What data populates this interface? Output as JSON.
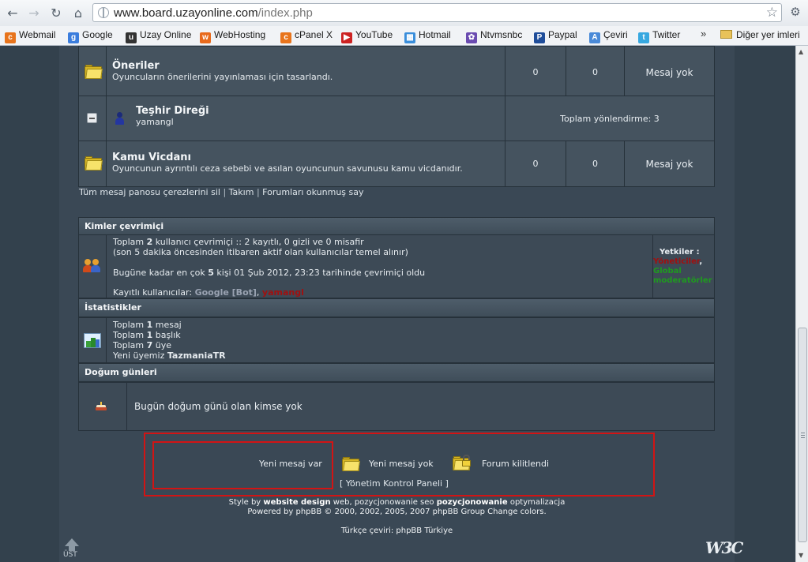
{
  "browser": {
    "url_host": "www.board.uzayonline.com",
    "url_path": "/index.php",
    "bookmarks": [
      {
        "label": "Webmail",
        "icon": "cpanel-icon",
        "color": "#e8741c"
      },
      {
        "label": "Google",
        "icon": "google-icon",
        "color": "#3b7ddd"
      },
      {
        "label": "Uzay Online",
        "icon": "uzay-icon",
        "color": "#333333"
      },
      {
        "label": "WebHosting",
        "icon": "webhosting-icon",
        "color": "#e86a1c"
      },
      {
        "label": "cPanel X",
        "icon": "cpanel-icon",
        "color": "#e8741c"
      },
      {
        "label": "YouTube",
        "icon": "youtube-icon",
        "color": "#cc2222"
      },
      {
        "label": "Hotmail",
        "icon": "windows-icon",
        "color": "#3a8edb"
      },
      {
        "label": "Ntvmsnbc",
        "icon": "nbc-icon",
        "color": "#6a4bb0"
      },
      {
        "label": "Paypal",
        "icon": "paypal-icon",
        "color": "#1f4d9a"
      },
      {
        "label": "Çeviri",
        "icon": "translate-icon",
        "color": "#4a8ad8"
      },
      {
        "label": "Twitter",
        "icon": "twitter-icon",
        "color": "#37a8e0"
      }
    ],
    "more_chevron": "»",
    "other_bookmarks": "Diğer yer imleri"
  },
  "forums": [
    {
      "title": "Öneriler",
      "desc": "Oyuncuların önerilerini yayınlaması için tasarlandı.",
      "topics": "0",
      "posts": "0",
      "last": "Mesaj yok"
    },
    {
      "title": "Teşhir Direği",
      "desc": "yamangl",
      "redirect": "Toplam yönlendirme: 3"
    },
    {
      "title": "Kamu Vicdanı",
      "desc": "Oyuncunun ayrıntılı ceza sebebi ve asılan oyuncunun savunusu kamu vicdanıdır.",
      "topics": "0",
      "posts": "0",
      "last": "Mesaj yok"
    }
  ],
  "links": {
    "delete_cookies": "Tüm mesaj panosu çerezlerini sil",
    "team": "Takım",
    "mark_read": "Forumları okunmuş say",
    "sep": "|"
  },
  "online": {
    "header": "Kimler çevrimiçi",
    "line1_a": "Toplam ",
    "line1_b": "2",
    "line1_c": " kullanıcı çevrimiçi :: 2 kayıtlı, 0 gizli ve 0 misafir",
    "line2": "(son 5 dakika öncesinden itibaren aktif olan kullanıcılar temel alınır)",
    "record_a": "Bugüne kadar en çok ",
    "record_b": "5",
    "record_c": " kişi 01 Şub 2012, 23:23 tarihinde çevrimiçi oldu",
    "registered_label": "Kayıtlı kullanıcılar: ",
    "user_bot": "Google [Bot]",
    "user_sep": ", ",
    "user_yamangl": "yamangl",
    "legend_title": "Yetkiler :",
    "legend_admins": "Yöneticiler",
    "legend_comma": ",",
    "legend_mods_1": "Global",
    "legend_mods_2": "moderatörler"
  },
  "stats": {
    "header": "İstatistikler",
    "posts_a": "Toplam ",
    "posts_b": "1",
    "posts_c": " mesaj",
    "topics_a": "Toplam ",
    "topics_b": "1",
    "topics_c": " başlık",
    "users_a": "Toplam ",
    "users_b": "7",
    "users_c": " üye",
    "newest_a": "Yeni üyemiz ",
    "newest_b": "TazmaniaTR"
  },
  "birthdays": {
    "header": "Doğum günleri",
    "text": "Bugün doğum günü olan kimse yok"
  },
  "legend": {
    "new_posts": "Yeni mesaj var",
    "no_new_posts": "Yeni mesaj yok",
    "locked": "Forum kilitlendi",
    "acp": "[ Yönetim Kontrol Paneli ]"
  },
  "footer": {
    "style_a": "Style by ",
    "style_b": "website design",
    "style_c": " web, pozycjonowanie seo ",
    "style_d": "pozycjonowanie",
    "style_e": " optymalizacja",
    "powered": "Powered by phpBB © 2000, 2002, 2005, 2007 phpBB Group Change colors.",
    "translation": "Türkçe çeviri: phpBB Türkiye",
    "top_label": "ÜST",
    "w3c": "W3C"
  },
  "colors": {
    "admin": "#a01010",
    "moderator": "#1f9a1f",
    "bot": "#9aa3b2",
    "highlight_box": "#d21414"
  }
}
